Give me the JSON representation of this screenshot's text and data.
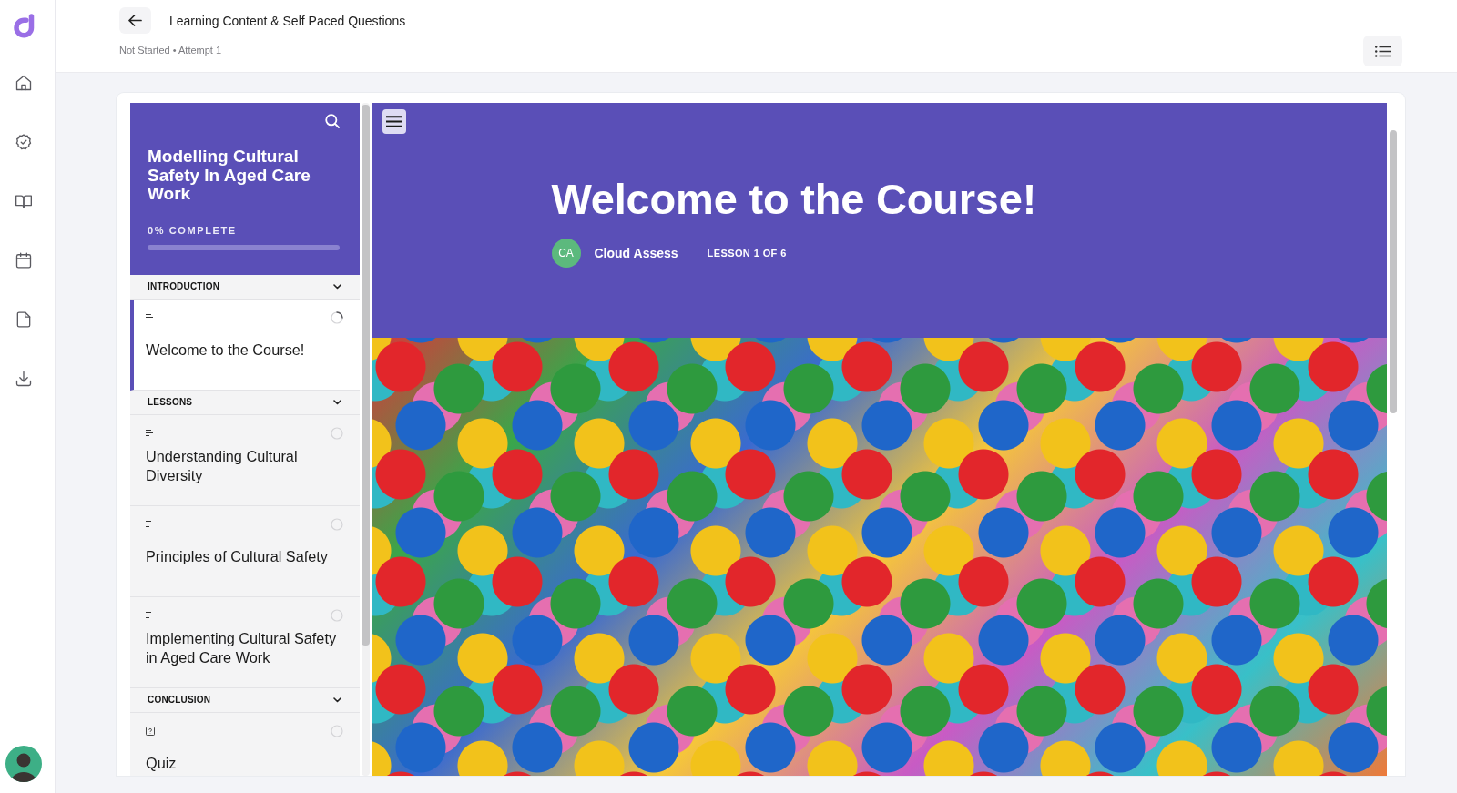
{
  "header": {
    "title": "Learning Content & Self Paced Questions",
    "subtitle": "Not Started • Attempt 1"
  },
  "course": {
    "title": "Modelling Cultural Safety In Aged Care Work",
    "progress": {
      "label": "0% COMPLETE",
      "level": 0
    },
    "sections": [
      {
        "title": "INTRODUCTION",
        "expanded": true,
        "items": [
          {
            "kind": "lesson",
            "title": "Welcome to the Course!",
            "selected": true,
            "in_progress": true
          }
        ]
      },
      {
        "title": "LESSONS",
        "expanded": true,
        "items": [
          {
            "kind": "lesson",
            "title": "Understanding Cultural Diversity",
            "selected": false,
            "in_progress": false
          },
          {
            "kind": "lesson",
            "title": "Principles of Cultural Safety",
            "selected": false,
            "in_progress": false
          },
          {
            "kind": "lesson",
            "title": "Implementing Cultural Safety in Aged Care Work",
            "selected": false,
            "in_progress": false
          }
        ]
      },
      {
        "title": "CONCLUSION",
        "expanded": true,
        "items": [
          {
            "kind": "quiz",
            "title": "Quiz",
            "selected": false,
            "in_progress": false
          }
        ]
      }
    ]
  },
  "lesson": {
    "title": "Welcome to the Course!",
    "author_initials": "CA",
    "author": "Cloud Assess",
    "position": "LESSON 1 OF 6"
  }
}
